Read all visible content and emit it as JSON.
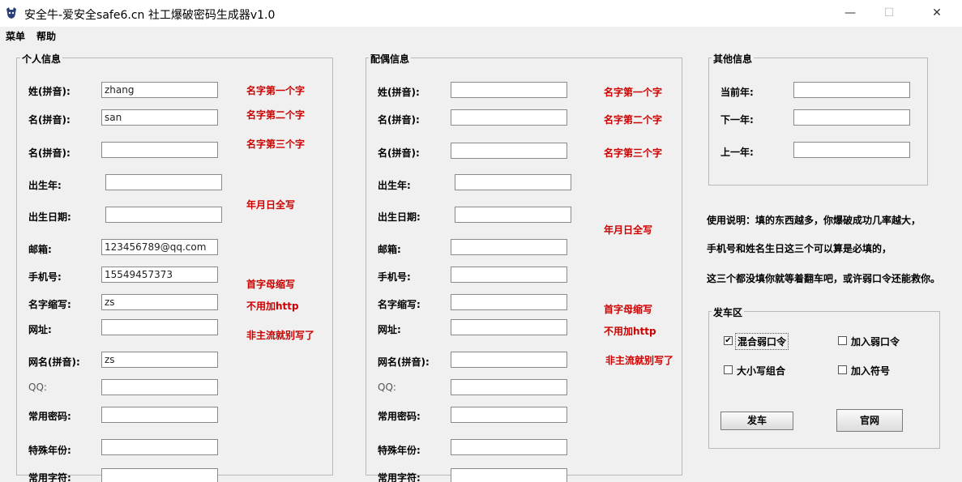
{
  "window": {
    "title": "安全牛-爱安全safe6.cn  社工爆破密码生成器v1.0",
    "minimize_glyph": "—",
    "maximize_glyph": "☐",
    "close_glyph": "✕"
  },
  "menu": [
    "菜单",
    "帮助"
  ],
  "personal": {
    "title": "个人信息",
    "labels": {
      "surname": "姓(拼音):",
      "given1": "名(拼音):",
      "given2": "名(拼音):",
      "birth_year": "出生年:",
      "birth_date": "出生日期:",
      "email": "邮箱:",
      "phone": "手机号:",
      "abbr": "名字缩写:",
      "website": "网址:",
      "nickname": "网名(拼音):",
      "qq": "QQ:",
      "common_pwd": "常用密码:",
      "special_year": "特殊年份:",
      "common_word": "常用字符:"
    },
    "values": {
      "surname": "zhang",
      "given1": "san",
      "given2": "",
      "birth_year": "",
      "birth_date": "",
      "email": "123456789@qq.com",
      "phone": "15549457373",
      "abbr": "zs",
      "website": "",
      "nickname": "zs",
      "qq": "",
      "common_pwd": "",
      "special_year": "",
      "common_word": ""
    },
    "hints": {
      "first_char": "名字第一个字",
      "second_char": "名字第二个字",
      "third_char": "名字第三个字",
      "full_date": "年月日全写",
      "initials": "首字母缩写",
      "no_http": "不用加http",
      "non_main": "非主流就别写了"
    }
  },
  "spouse": {
    "title": "配偶信息",
    "labels": {
      "surname": "姓(拼音):",
      "given1": "名(拼音):",
      "given2": "名(拼音):",
      "birth_year": "出生年:",
      "birth_date": "出生日期:",
      "email": "邮箱:",
      "phone": "手机号:",
      "abbr": "名字缩写:",
      "website": "网址:",
      "nickname": "网名(拼音):",
      "qq": "QQ:",
      "common_pwd": "常用密码:",
      "special_year": "特殊年份:",
      "common_word": "常用字符:"
    },
    "hints": {
      "first_char": "名字第一个字",
      "second_char": "名字第二个字",
      "third_char": "名字第三个字",
      "full_date": "年月日全写",
      "initials": "首字母缩写",
      "no_http": "不用加http",
      "non_main": "非主流就别写了"
    }
  },
  "other": {
    "title": "其他信息",
    "labels": {
      "current_year": "当前年:",
      "next_year": "下一年:",
      "last_year": "上一年:"
    }
  },
  "instructions": [
    "使用说明：填的东西越多，你爆破成功几率越大，",
    "手机号和姓名生日这三个可以算是必填的，",
    "这三个都没填你就等着翻车吧，或许弱口令还能救你。"
  ],
  "launch": {
    "title": "发车区",
    "options": {
      "mix_weak": {
        "label": "混合弱口令",
        "checked": true
      },
      "add_weak": {
        "label": "加入弱口令",
        "checked": false
      },
      "case_combo": {
        "label": "大小写组合",
        "checked": false
      },
      "add_symbol": {
        "label": "加入符号",
        "checked": false
      }
    },
    "check_glyph": "✔",
    "go_button": "发车",
    "site_button": "官网"
  }
}
